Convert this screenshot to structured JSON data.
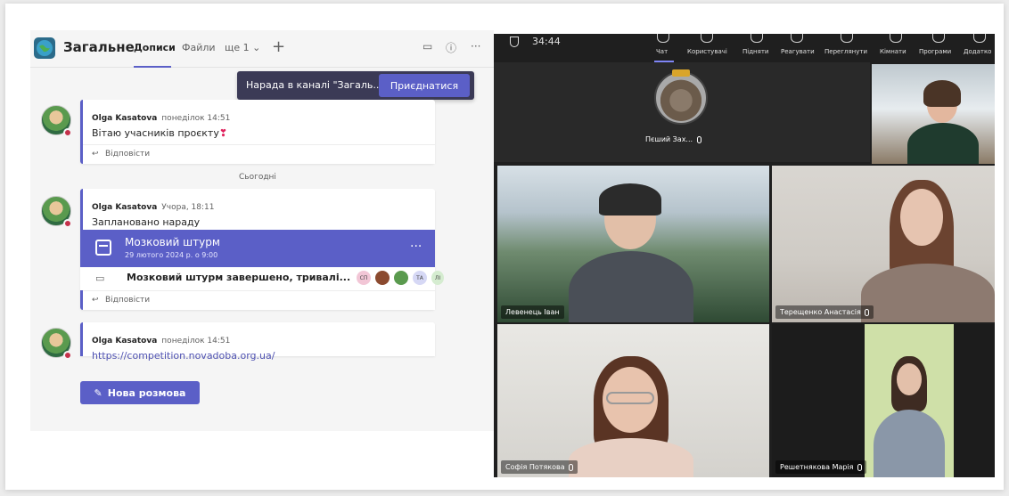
{
  "channel": {
    "title": "Загальне",
    "tabs": [
      "Дописи",
      "Файли",
      "ще 1"
    ],
    "active_tab": "Дописи"
  },
  "banner": {
    "text": "Нарада в каналі \"Загаль...",
    "join_label": "Приєднатися"
  },
  "messages": [
    {
      "author": "Olga Kasatova",
      "time": "понеділок 14:51",
      "text": "Вітаю учасників проєкту",
      "emoji": "❣",
      "reply": "Відповісти"
    },
    {
      "author": "Olga Kasatova",
      "time": "Учора, 18:11",
      "text": "Заплановано нараду",
      "meeting_title": "Мозковий штурм",
      "meeting_date": "29 лютого 2024 р. о 9:00",
      "ended_text": "Мозковий штурм завершено, тривалі...",
      "chips": [
        "СП",
        "",
        "",
        "ТА",
        "ЛІ"
      ],
      "reply": "Відповісти"
    },
    {
      "author": "Olga Kasatova",
      "time": "понеділок 14:51",
      "link": "https://competition.novadoba.org.ua/"
    }
  ],
  "date_separator": "Сьогодні",
  "new_conversation_label": "Нова розмова",
  "meeting": {
    "timer": "34:44",
    "toolbar": [
      "Чат",
      "Користувачі",
      "Підняти",
      "Реагувати",
      "Переглянути",
      "Кімнати",
      "Програми",
      "Додатко"
    ],
    "participants": [
      {
        "name": "Пєший Зах..."
      },
      {
        "name": "Левенець Іван"
      },
      {
        "name": "Терещенко Анастасія"
      },
      {
        "name": "Софія Потякова"
      },
      {
        "name": "Решетнякова Марія"
      }
    ]
  },
  "colors": {
    "accent": "#5b5fc7",
    "banner": "#3b3a56",
    "meeting_bg": "#1f1f1f"
  }
}
